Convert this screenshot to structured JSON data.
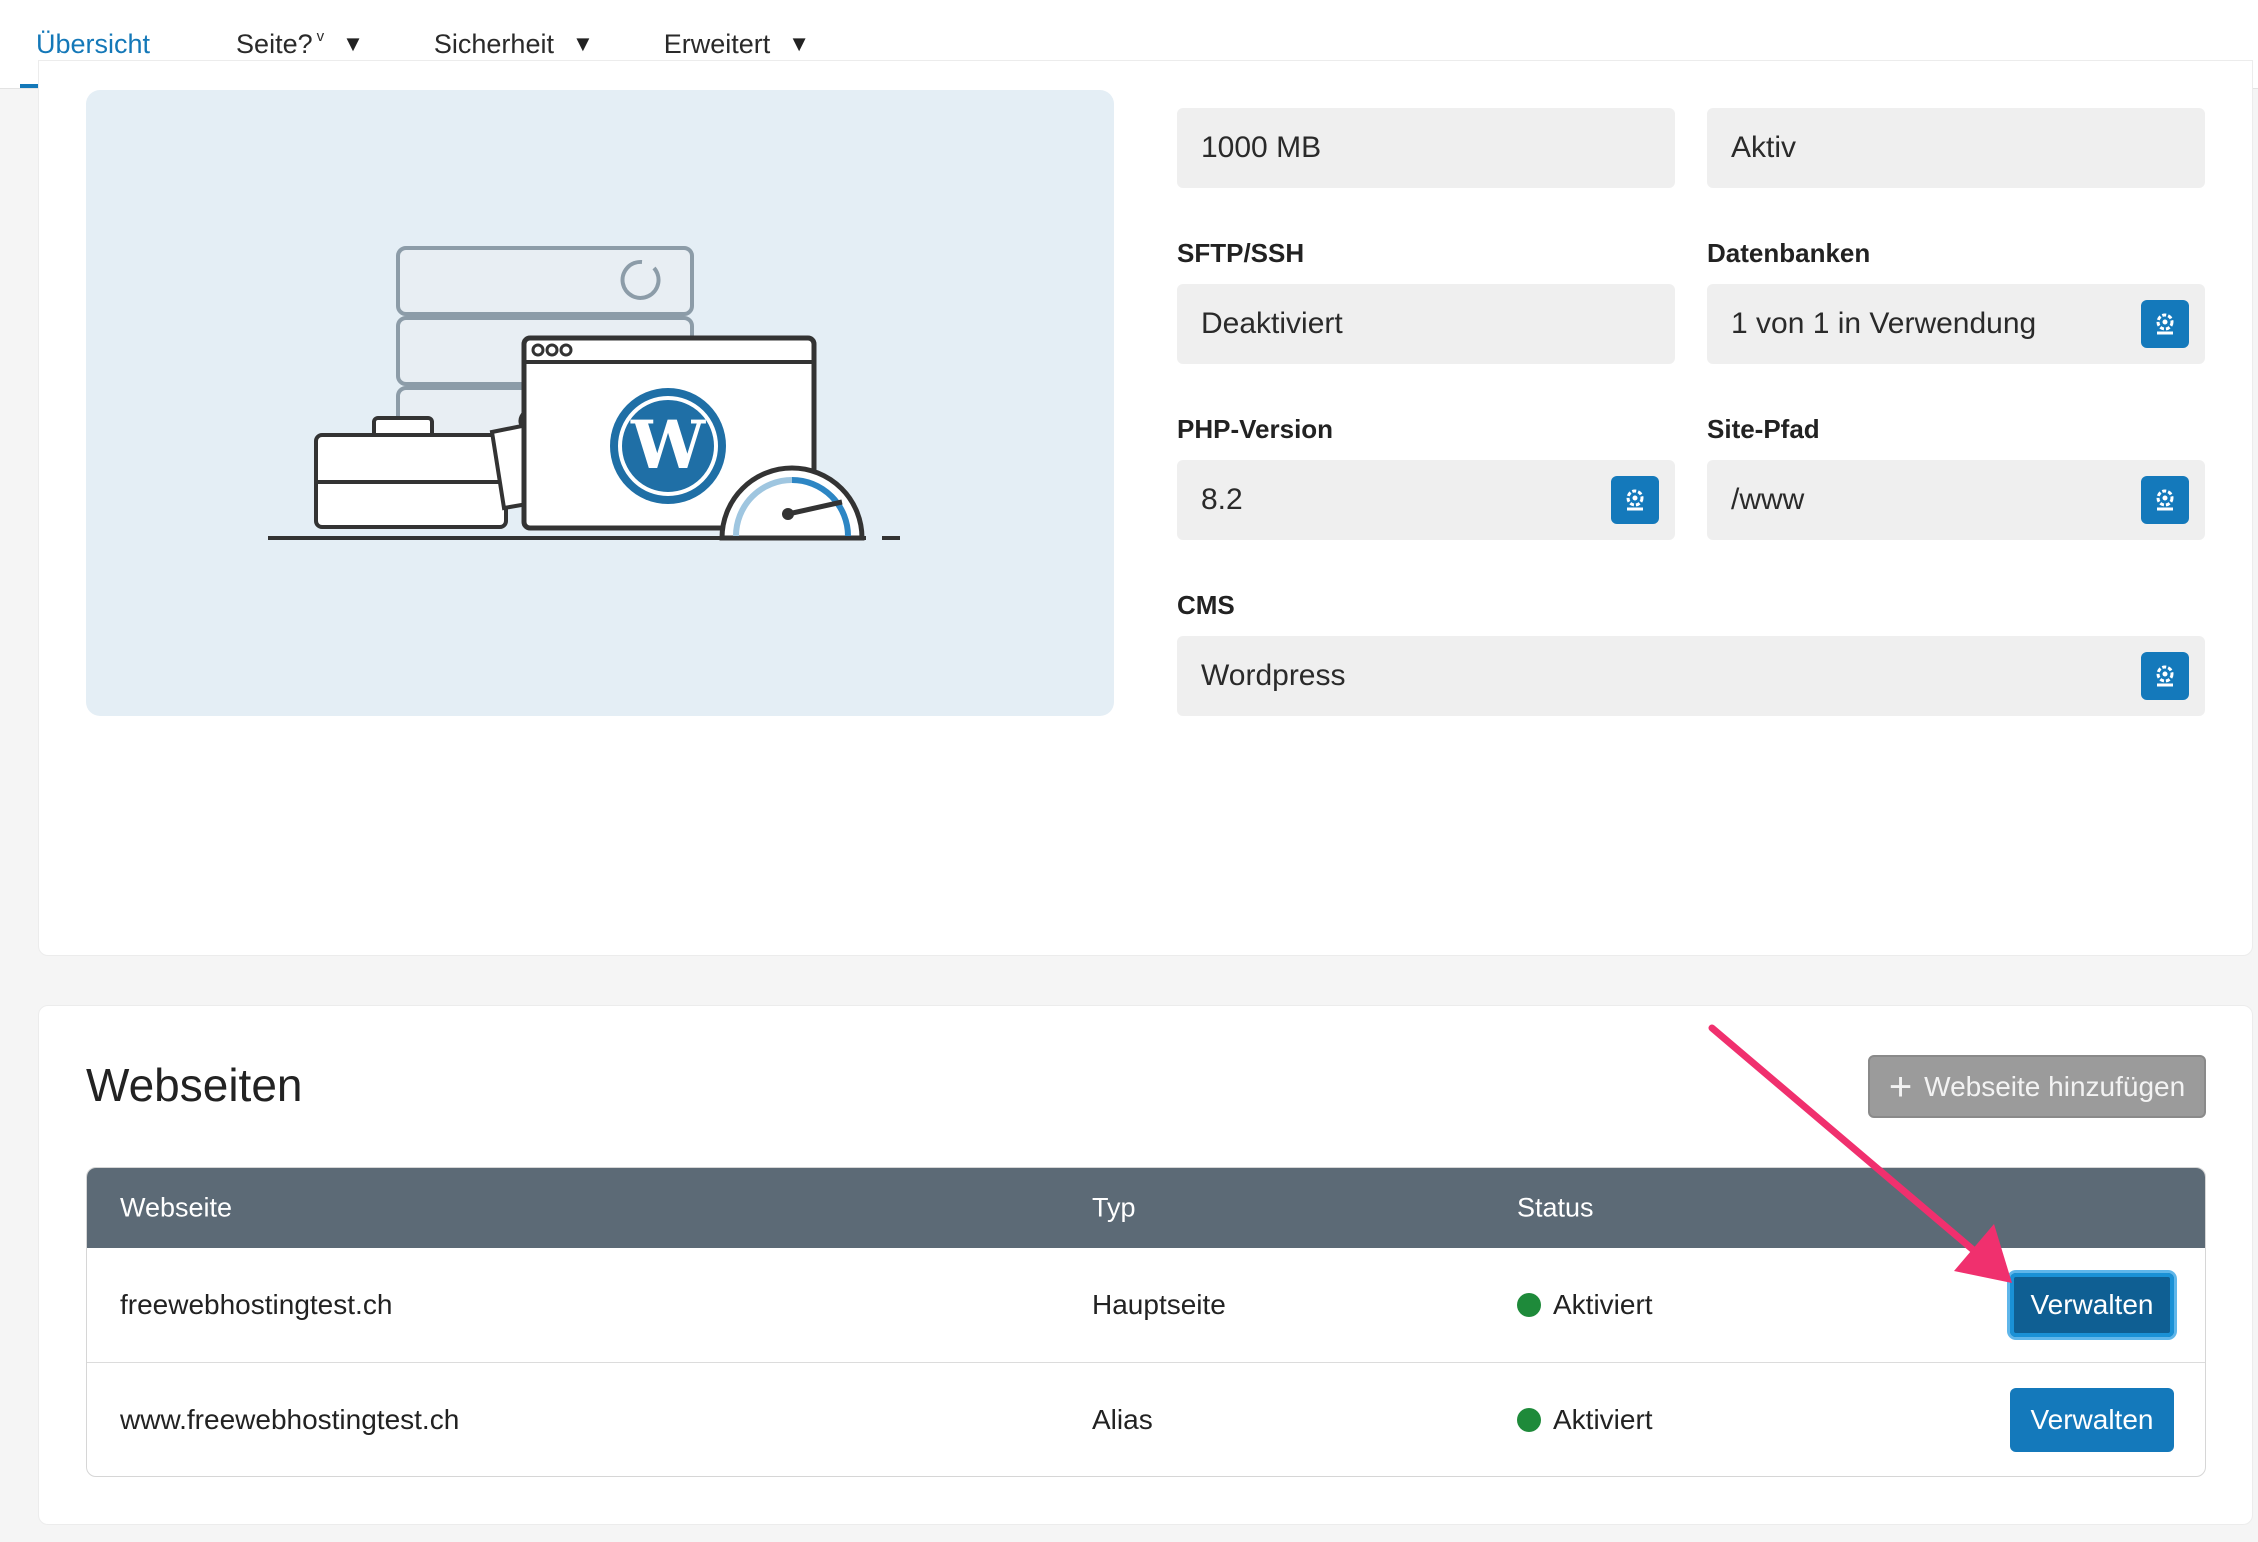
{
  "nav": {
    "items": [
      {
        "label": "Übersicht",
        "active": true
      },
      {
        "label": "Seite?",
        "sup": "v"
      },
      {
        "label": "Sicherheit"
      },
      {
        "label": "Erweitert"
      }
    ],
    "caret": "▼"
  },
  "info": {
    "storage_value": "1000 MB",
    "status_value": "Aktiv",
    "sftp_label": "SFTP/SSH",
    "sftp_value": "Deaktiviert",
    "db_label": "Datenbanken",
    "db_value": "1 von 1 in Verwendung",
    "php_label": "PHP-Version",
    "php_value": "8.2",
    "path_label": "Site-Pfad",
    "path_value": "/www",
    "cms_label": "CMS",
    "cms_value": "Wordpress",
    "gear_icon": "gear-icon"
  },
  "websites": {
    "title": "Webseiten",
    "add_button": "Webseite hinzufügen",
    "columns": [
      "Webseite",
      "Typ",
      "Status"
    ],
    "rows": [
      {
        "site": "freewebhostingtest.ch",
        "type": "Hauptseite",
        "status": "Aktiviert",
        "action": "Verwalten"
      },
      {
        "site": "www.freewebhostingtest.ch",
        "type": "Alias",
        "status": "Aktiviert",
        "action": "Verwalten"
      }
    ]
  },
  "colors": {
    "accent": "#1479bb",
    "header_bg": "#5c6a76",
    "status_green": "#1e8a3a",
    "annotation_arrow": "#f0306e",
    "illustration_bg": "#e4eef5"
  }
}
